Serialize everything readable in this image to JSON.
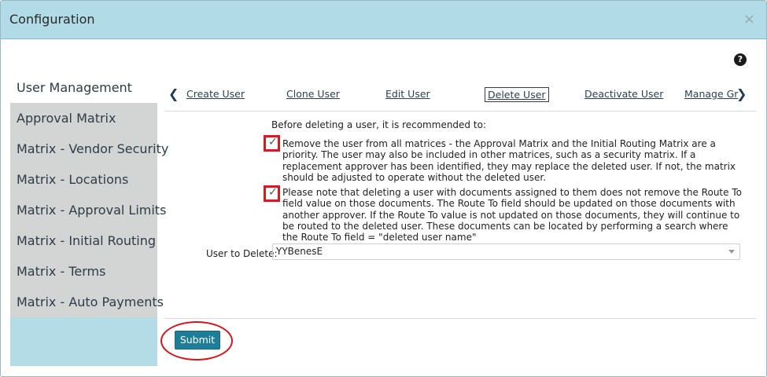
{
  "dialog": {
    "title": "Configuration",
    "close_symbol": "×",
    "help_symbol": "?"
  },
  "sidebar": {
    "items": [
      {
        "label": "User Management",
        "active": true
      },
      {
        "label": "Approval Matrix"
      },
      {
        "label": "Matrix - Vendor Security"
      },
      {
        "label": "Matrix - Locations"
      },
      {
        "label": "Matrix - Approval Limits"
      },
      {
        "label": "Matrix - Initial Routing"
      },
      {
        "label": "Matrix - Terms"
      },
      {
        "label": "Matrix - Auto Payments"
      }
    ]
  },
  "tabs": {
    "prev_symbol": "❮",
    "next_symbol": "❯",
    "items": [
      {
        "label": "Create User"
      },
      {
        "label": "Clone User"
      },
      {
        "label": "Edit User"
      },
      {
        "label": "Delete User",
        "active": true
      },
      {
        "label": "Deactivate User"
      },
      {
        "label": "Manage Gr"
      }
    ]
  },
  "content": {
    "intro": "Before deleting a user, it is recommended to:",
    "notes": [
      {
        "text": "Remove the user from all matrices - the Approval Matrix and the Initial Routing Matrix are a priority. The user may also be included in other matrices, such as a security matrix. If a replacement approver has been identified, they may replace the deleted user. If not, the matrix should be adjusted to operate without the deleted user.",
        "checked": true
      },
      {
        "text": "Please note that deleting a user with documents assigned to them does not remove the Route To field value on those documents. The Route To field should be updated on those documents with another approver. If the Route To value is not updated on those documents, they will continue to be routed to the deleted user. These documents can be located by performing a search where the Route To field = \"deleted user name\"",
        "checked": true
      }
    ],
    "check_symbol": "✓",
    "user_to_delete_label": "User to Delete:",
    "user_to_delete_value": "YYBenesE"
  },
  "footer": {
    "submit_label": "Submit"
  },
  "colors": {
    "titlebar": "#b1dbe6",
    "sidebar_item": "#d3d5d5",
    "submit": "#1e7d98",
    "annotation": "#e3141b"
  }
}
